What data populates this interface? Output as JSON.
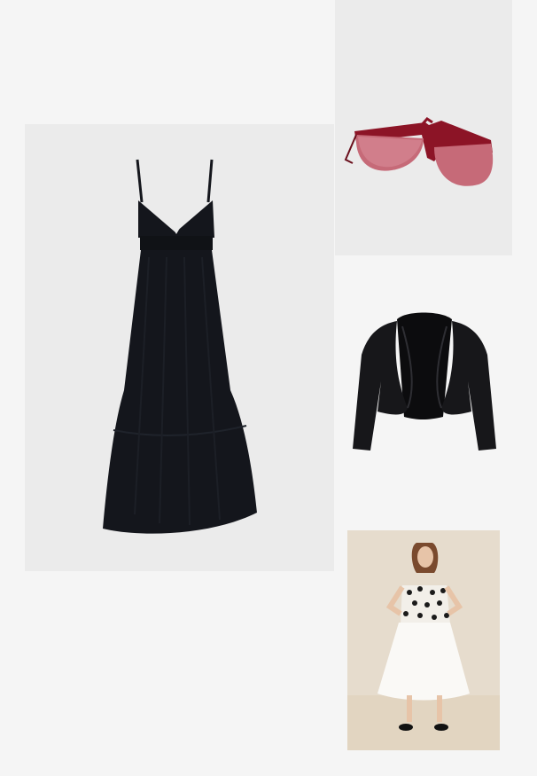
{
  "collage": {
    "items": [
      {
        "id": "dress",
        "icon": "black-maxi-dress-image",
        "color": "#14161c"
      },
      {
        "id": "sunglasses",
        "icon": "red-sunglasses-image",
        "color": "#8c1426"
      },
      {
        "id": "bolero",
        "icon": "black-bolero-image",
        "color": "#17171a"
      },
      {
        "id": "model",
        "icon": "polka-dot-outfit-photo",
        "color": "#f2efe9"
      }
    ]
  },
  "colors": {
    "page_background": "#f5f5f5",
    "tile_background": "#ebebeb",
    "photo_background": "#e6dccd"
  }
}
